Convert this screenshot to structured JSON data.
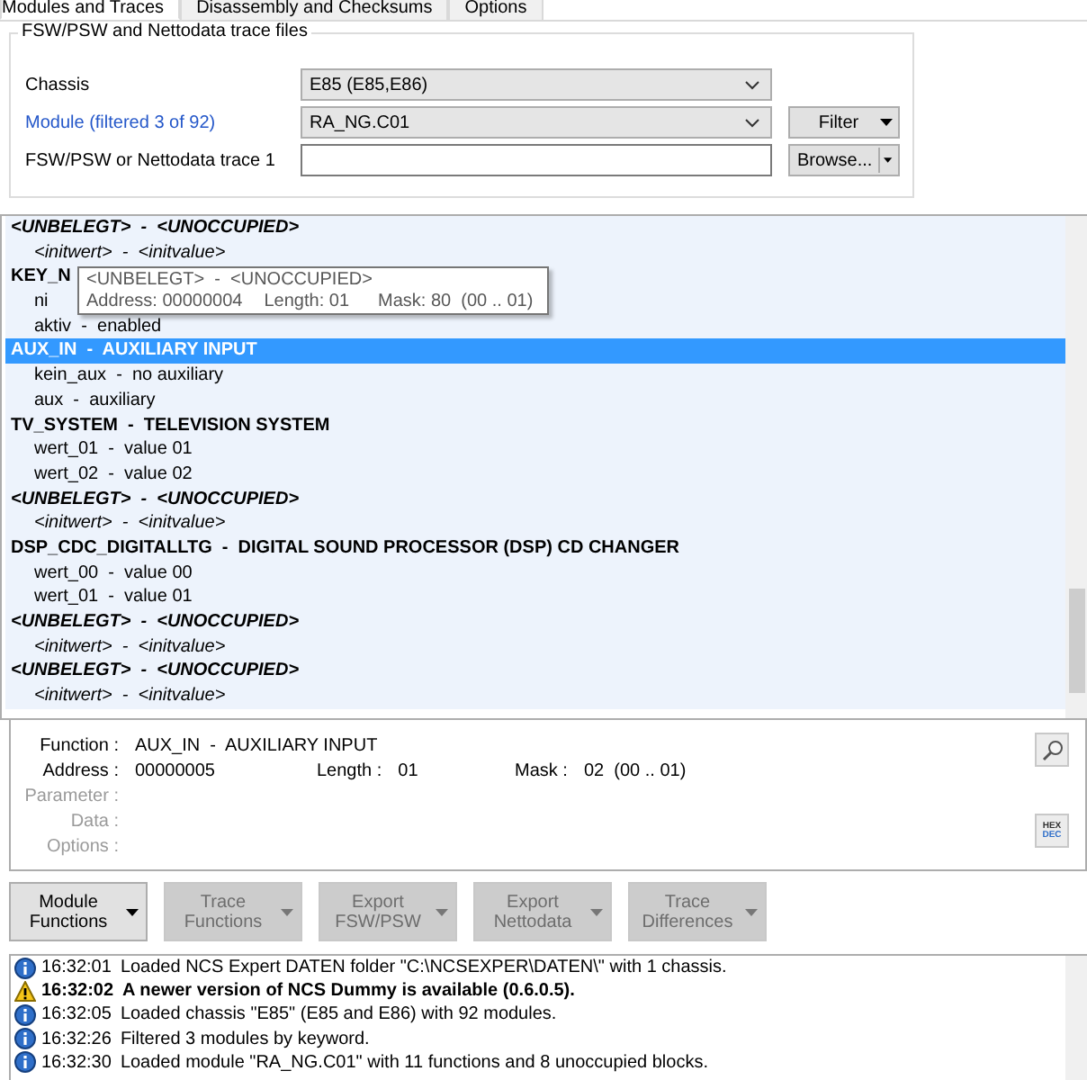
{
  "tabs": [
    {
      "label": "Modules and Traces",
      "selected": true
    },
    {
      "label": "Disassembly and Checksums",
      "selected": false
    },
    {
      "label": "Options",
      "selected": false
    }
  ],
  "trace_files": {
    "title": "FSW/PSW and Nettodata trace files",
    "rows": [
      {
        "kind": "combo",
        "label": "Chassis",
        "link": false,
        "value": "E85  (E85,E86)"
      },
      {
        "kind": "combo",
        "label": "Module (filtered 3 of 92)",
        "link": true,
        "value": "RA_NG.C01",
        "button": "Filter",
        "split": false
      },
      {
        "kind": "input",
        "label": "FSW/PSW or Nettodata trace 1",
        "link": false,
        "value": "",
        "button": "Browse...",
        "split": true
      }
    ]
  },
  "function_list": {
    "rows": [
      {
        "kind": "unoccupied",
        "text": "<UNBELEGT>  -  <UNOCCUPIED>",
        "selected": false
      },
      {
        "kind": "initvalue",
        "text": "<initwert>  -  <initvalue>",
        "selected": false
      },
      {
        "kind": "function",
        "text": "KEY_N",
        "selected": false
      },
      {
        "kind": "value",
        "text": "ni",
        "selected": false
      },
      {
        "kind": "value",
        "text": "aktiv  -  enabled",
        "selected": false
      },
      {
        "kind": "function",
        "text": "AUX_IN  -  AUXILIARY INPUT",
        "selected": true
      },
      {
        "kind": "value",
        "text": "kein_aux  -  no auxiliary",
        "selected": false
      },
      {
        "kind": "value",
        "text": "aux  -  auxiliary",
        "selected": false
      },
      {
        "kind": "function",
        "text": "TV_SYSTEM  -  TELEVISION SYSTEM",
        "selected": false
      },
      {
        "kind": "value",
        "text": "wert_01  -  value 01",
        "selected": false
      },
      {
        "kind": "value",
        "text": "wert_02  -  value 02",
        "selected": false
      },
      {
        "kind": "unoccupied",
        "text": "<UNBELEGT>  -  <UNOCCUPIED>",
        "selected": false
      },
      {
        "kind": "initvalue",
        "text": "<initwert>  -  <initvalue>",
        "selected": false
      },
      {
        "kind": "function",
        "text": "DSP_CDC_DIGITALLTG  -  DIGITAL SOUND PROCESSOR (DSP) CD CHANGER",
        "selected": false
      },
      {
        "kind": "value",
        "text": "wert_00  -  value 00",
        "selected": false
      },
      {
        "kind": "value",
        "text": "wert_01  -  value 01",
        "selected": false
      },
      {
        "kind": "unoccupied",
        "text": "<UNBELEGT>  -  <UNOCCUPIED>",
        "selected": false
      },
      {
        "kind": "initvalue",
        "text": "<initwert>  -  <initvalue>",
        "selected": false
      },
      {
        "kind": "unoccupied",
        "text": "<UNBELEGT>  -  <UNOCCUPIED>",
        "selected": false
      },
      {
        "kind": "initvalue",
        "text": "<initwert>  -  <initvalue>",
        "selected": false
      }
    ],
    "tooltip": {
      "title": "<UNBELEGT>  -  <UNOCCUPIED>",
      "address": "Address: 00000004",
      "length": "Length: 01",
      "mask": "Mask: 80  (00 .. 01)"
    }
  },
  "details": {
    "rows": [
      {
        "disabled": false,
        "cells": [
          {
            "label": "Function :",
            "value": "AUX_IN  -  AUXILIARY INPUT"
          }
        ]
      },
      {
        "disabled": false,
        "cells": [
          {
            "label": "Address :",
            "value": "00000005"
          },
          {
            "label": "Length :",
            "value": "01"
          },
          {
            "label": "Mask :",
            "value": "02  (00 .. 01)"
          }
        ]
      },
      {
        "disabled": true,
        "cells": [
          {
            "label": "Parameter :"
          }
        ]
      },
      {
        "disabled": true,
        "cells": [
          {
            "label": "Data :"
          }
        ]
      },
      {
        "disabled": true,
        "cells": [
          {
            "label": "Options :"
          }
        ]
      }
    ],
    "hex_dec": {
      "top": "HEX",
      "bottom": "DEC"
    }
  },
  "actions": [
    {
      "lines": [
        "Module",
        "Functions"
      ],
      "disabled": false
    },
    {
      "lines": [
        "Trace",
        "Functions"
      ],
      "disabled": true
    },
    {
      "lines": [
        "Export",
        "FSW/PSW"
      ],
      "disabled": true
    },
    {
      "lines": [
        "Export",
        "Nettodata"
      ],
      "disabled": true
    },
    {
      "lines": [
        "Trace",
        "Differences"
      ],
      "disabled": true
    }
  ],
  "log": [
    {
      "kind": "info",
      "time": "16:32:01",
      "message": "Loaded NCS Expert DATEN folder \"C:\\NCSEXPER\\DATEN\\\" with 1 chassis."
    },
    {
      "kind": "warning",
      "time": "16:32:02",
      "message": "A newer version of NCS Dummy is available (0.6.0.5)."
    },
    {
      "kind": "info",
      "time": "16:32:05",
      "message": "Loaded chassis \"E85\" (E85 and E86) with 92 modules."
    },
    {
      "kind": "info",
      "time": "16:32:26",
      "message": "Filtered 3 modules by keyword."
    },
    {
      "kind": "info",
      "time": "16:32:30",
      "message": "Loaded module \"RA_NG.C01\" with 11 functions and 8 unoccupied blocks."
    }
  ]
}
